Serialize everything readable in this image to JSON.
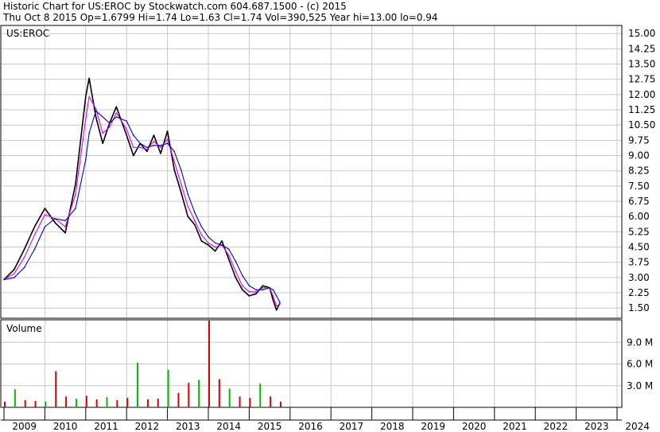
{
  "header": {
    "line1": "Historic Chart for US:EROC by Stockwatch.com 604.687.1500 - (c) 2015",
    "line2": "Thu Oct  8 2015   Op=1.6799   Hi=1.74   Lo=1.63   Cl=1.74   Vol=390,525   Year hi=13.00   lo=0.94"
  },
  "chart_data": [
    {
      "type": "line",
      "panel": "price",
      "label": "US:EROC",
      "ylim": [
        1.0,
        15.4
      ],
      "y_ticks": [
        "15.00",
        "14.25",
        "13.50",
        "12.75",
        "12.00",
        "11.25",
        "10.50",
        "9.75",
        "9.00",
        "8.25",
        "7.50",
        "6.75",
        "6.00",
        "5.25",
        "4.50",
        "3.75",
        "3.00",
        "2.25",
        "1.50"
      ],
      "x": [
        "2009-01",
        "2009-04",
        "2009-07",
        "2009-10",
        "2010-01",
        "2010-04",
        "2010-07",
        "2010-10",
        "2011-01",
        "2011-02",
        "2011-04",
        "2011-06",
        "2011-08",
        "2011-10",
        "2012-01",
        "2012-03",
        "2012-05",
        "2012-07",
        "2012-09",
        "2012-11",
        "2013-01",
        "2013-03",
        "2013-05",
        "2013-07",
        "2013-09",
        "2013-11",
        "2014-01",
        "2014-03",
        "2014-05",
        "2014-07",
        "2014-09",
        "2014-11",
        "2015-01",
        "2015-03",
        "2015-05",
        "2015-07",
        "2015-08",
        "2015-09",
        "2015-10"
      ],
      "series": [
        {
          "color": "#000000",
          "values": [
            2.9,
            3.4,
            4.4,
            5.5,
            6.4,
            5.7,
            5.2,
            7.6,
            11.9,
            12.8,
            10.9,
            9.6,
            10.6,
            11.4,
            10.0,
            9.0,
            9.6,
            9.2,
            10.0,
            9.1,
            10.2,
            8.3,
            7.2,
            6.0,
            5.6,
            4.8,
            4.6,
            4.3,
            4.8,
            3.9,
            3.0,
            2.4,
            2.1,
            2.2,
            2.6,
            2.5,
            1.9,
            1.4,
            1.74
          ]
        },
        {
          "color": "#e000e0",
          "values": [
            2.9,
            3.2,
            4.0,
            5.1,
            6.1,
            5.9,
            5.5,
            7.1,
            10.8,
            11.9,
            11.3,
            10.1,
            10.4,
            11.1,
            10.3,
            9.4,
            9.4,
            9.3,
            9.7,
            9.4,
            9.8,
            8.7,
            7.6,
            6.5,
            5.8,
            5.1,
            4.7,
            4.5,
            4.6,
            4.1,
            3.3,
            2.6,
            2.3,
            2.3,
            2.5,
            2.5,
            2.1,
            1.6,
            1.7
          ]
        },
        {
          "color": "#0000cc",
          "values": [
            2.9,
            3.0,
            3.5,
            4.4,
            5.5,
            5.9,
            5.8,
            6.4,
            8.8,
            10.1,
            11.2,
            10.9,
            10.6,
            10.9,
            10.7,
            10.0,
            9.6,
            9.4,
            9.5,
            9.5,
            9.6,
            9.2,
            8.3,
            7.1,
            6.2,
            5.5,
            5.0,
            4.7,
            4.6,
            4.4,
            3.8,
            3.1,
            2.6,
            2.4,
            2.4,
            2.5,
            2.4,
            2.1,
            1.8
          ]
        }
      ]
    },
    {
      "type": "bar",
      "panel": "volume",
      "label": "Volume",
      "ylim": [
        0,
        12.0
      ],
      "y_ticks": [
        "9.0 M",
        "6.0 M",
        "3.0 M"
      ],
      "x_ticks": [
        "2009",
        "2010",
        "2011",
        "2012",
        "2013",
        "2014",
        "2015",
        "2016",
        "2017",
        "2018",
        "2019",
        "2020",
        "2021",
        "2022",
        "2023",
        "2024"
      ],
      "categories": [
        "2009-01",
        "2009-04",
        "2009-07",
        "2009-10",
        "2010-01",
        "2010-04",
        "2010-07",
        "2010-10",
        "2011-01",
        "2011-04",
        "2011-07",
        "2011-10",
        "2012-01",
        "2012-04",
        "2012-07",
        "2012-10",
        "2013-01",
        "2013-04",
        "2013-07",
        "2013-10",
        "2014-01",
        "2014-04",
        "2014-07",
        "2014-10",
        "2015-01",
        "2015-04",
        "2015-07",
        "2015-10"
      ],
      "values": [
        0.8,
        2.5,
        1.0,
        0.9,
        0.8,
        5.0,
        1.5,
        1.2,
        1.6,
        1.1,
        1.4,
        1.0,
        1.3,
        6.2,
        1.1,
        1.2,
        5.2,
        2.0,
        3.4,
        3.8,
        12.0,
        3.9,
        2.6,
        1.5,
        1.3,
        3.3,
        1.5,
        0.8
      ]
    }
  ]
}
